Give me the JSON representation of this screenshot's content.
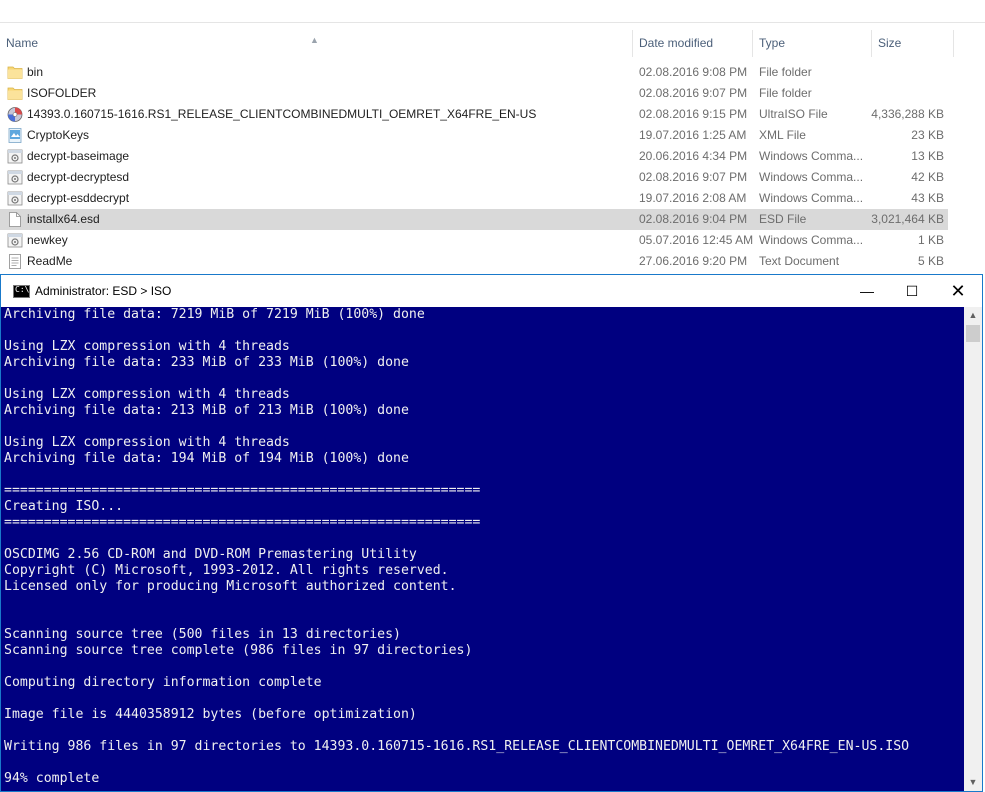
{
  "explorer": {
    "columns": {
      "name": "Name",
      "date": "Date modified",
      "type": "Type",
      "size": "Size"
    },
    "files": [
      {
        "name": "bin",
        "date": "02.08.2016 9:08 PM",
        "type": "File folder",
        "size": "",
        "icon": "folder-icon"
      },
      {
        "name": "ISOFOLDER",
        "date": "02.08.2016 9:07 PM",
        "type": "File folder",
        "size": "",
        "icon": "folder-icon"
      },
      {
        "name": "14393.0.160715-1616.RS1_RELEASE_CLIENTCOMBINEDMULTI_OEMRET_X64FRE_EN-US",
        "date": "02.08.2016 9:15 PM",
        "type": "UltraISO File",
        "size": "4,336,288 KB",
        "icon": "disc-icon"
      },
      {
        "name": "CryptoKeys",
        "date": "19.07.2016 1:25 AM",
        "type": "XML File",
        "size": "23 KB",
        "icon": "xml-file-icon"
      },
      {
        "name": "decrypt-baseimage",
        "date": "20.06.2016 4:34 PM",
        "type": "Windows Comma...",
        "size": "13 KB",
        "icon": "batch-file-icon"
      },
      {
        "name": "decrypt-decryptesd",
        "date": "02.08.2016 9:07 PM",
        "type": "Windows Comma...",
        "size": "42 KB",
        "icon": "batch-file-icon"
      },
      {
        "name": "decrypt-esddecrypt",
        "date": "19.07.2016 2:08 AM",
        "type": "Windows Comma...",
        "size": "43 KB",
        "icon": "batch-file-icon"
      },
      {
        "name": "installx64.esd",
        "date": "02.08.2016 9:04 PM",
        "type": "ESD File",
        "size": "3,021,464 KB",
        "icon": "blank-file-icon",
        "selected": true
      },
      {
        "name": "newkey",
        "date": "05.07.2016 12:45 AM",
        "type": "Windows Comma...",
        "size": "1 KB",
        "icon": "batch-file-icon"
      },
      {
        "name": "ReadMe",
        "date": "27.06.2016 9:20 PM",
        "type": "Text Document",
        "size": "5 KB",
        "icon": "text-file-icon"
      }
    ]
  },
  "console": {
    "title": "Administrator:  ESD > ISO",
    "icon_text": "C:\\",
    "min_glyph": "—",
    "max_glyph": "☐",
    "close_glyph": "✕",
    "lines": [
      "Archiving file data: 7219 MiB of 7219 MiB (100%) done",
      "",
      "Using LZX compression with 4 threads",
      "Archiving file data: 233 MiB of 233 MiB (100%) done",
      "",
      "Using LZX compression with 4 threads",
      "Archiving file data: 213 MiB of 213 MiB (100%) done",
      "",
      "Using LZX compression with 4 threads",
      "Archiving file data: 194 MiB of 194 MiB (100%) done",
      "",
      "============================================================",
      "Creating ISO...",
      "============================================================",
      "",
      "OSCDIMG 2.56 CD-ROM and DVD-ROM Premastering Utility",
      "Copyright (C) Microsoft, 1993-2012. All rights reserved.",
      "Licensed only for producing Microsoft authorized content.",
      "",
      "",
      "Scanning source tree (500 files in 13 directories)",
      "Scanning source tree complete (986 files in 97 directories)",
      "",
      "Computing directory information complete",
      "",
      "Image file is 4440358912 bytes (before optimization)",
      "",
      "Writing 986 files in 97 directories to 14393.0.160715-1616.RS1_RELEASE_CLIENTCOMBINEDMULTI_OEMRET_X64FRE_EN-US.ISO",
      "",
      "94% complete"
    ]
  },
  "colors": {
    "console_bg": "#000080",
    "console_text": "#f0f0f0",
    "selection": "#d9d9d9",
    "window_border": "#1979ca",
    "folder": "#f8d775"
  }
}
